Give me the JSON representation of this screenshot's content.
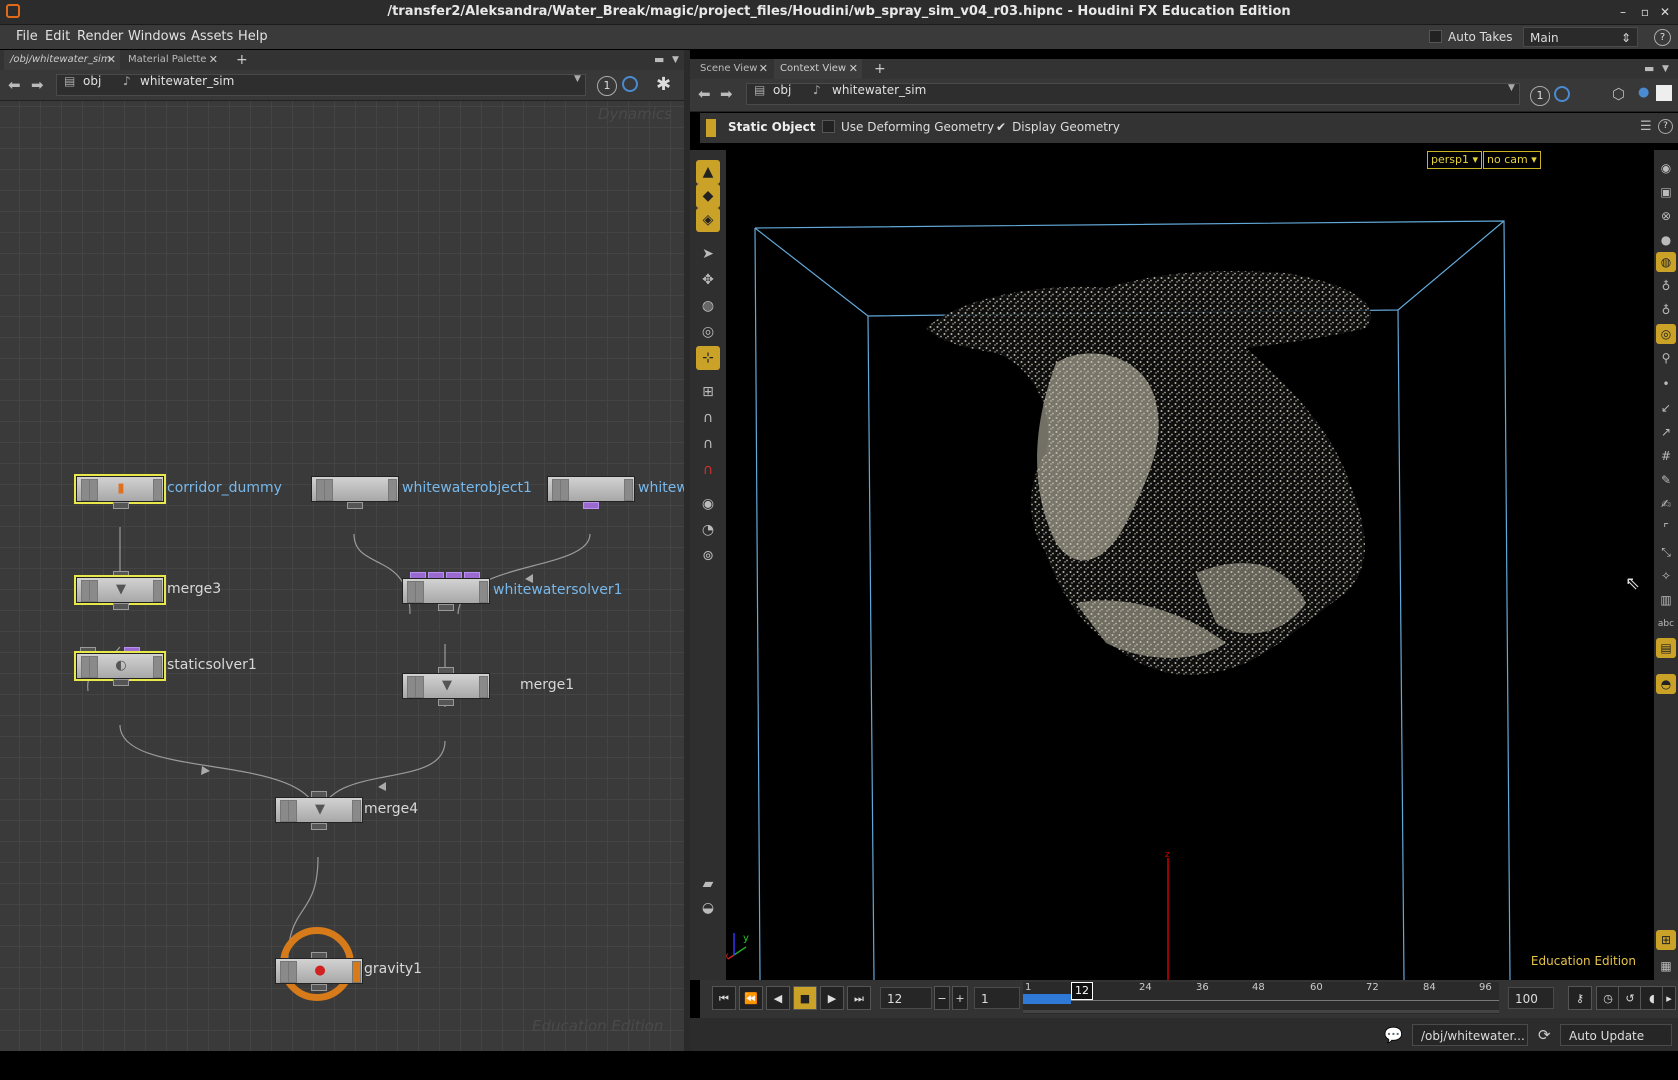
{
  "window": {
    "title": "/transfer2/Aleksandra/Water_Break/magic/project_files/Houdini/wb_spray_sim_v04_r03.hipnc - Houdini FX Education Edition",
    "logo_icon": "houdini-logo-icon"
  },
  "menu": {
    "items": [
      "File",
      "Edit",
      "Render",
      "Windows",
      "Assets",
      "Help"
    ],
    "auto_takes_label": "Auto Takes",
    "desktop_dropdown": "Main",
    "help_label": "?"
  },
  "left_pane": {
    "tabs": [
      "/obj/whitewater_sim",
      "Material Palette"
    ],
    "path": {
      "root": "obj",
      "node": "whitewater_sim"
    },
    "counter": "1",
    "network_watermark_top": "Dynamics",
    "network_watermark_bottom": "Education Edition",
    "nodes": {
      "corridor_dummy": "corridor_dummy",
      "whitewaterobject1": "whitewaterobject1",
      "whitew": "whitew",
      "merge3": "merge3",
      "whitewatersolver1": "whitewatersolver1",
      "staticsolver1": "staticsolver1",
      "merge1": "merge1",
      "merge4": "merge4",
      "gravity1": "gravity1"
    }
  },
  "right_pane": {
    "tabs": [
      "Scene View",
      "Context View"
    ],
    "path": {
      "root": "obj",
      "node": "whitewater_sim"
    },
    "counter": "1",
    "viewer_bar": {
      "static_object": "Static Object",
      "use_deforming_geometry": "Use Deforming Geometry",
      "display_geometry": "Display Geometry"
    },
    "camera": {
      "view": "persp1",
      "cam": "no cam"
    },
    "education_label": "Education Edition",
    "axis_labels": {
      "y": "y",
      "x": "x",
      "z": "z"
    },
    "colors": {
      "bbox": "#62a8d8",
      "particles": "#d8d4c0",
      "accent": "#c9a227"
    }
  },
  "playbar": {
    "current_frame": "12",
    "step": "1",
    "end_frame": "100",
    "timeline_start": "1",
    "timeline_current": "12",
    "ticks": [
      "24",
      "36",
      "48",
      "60",
      "72",
      "84",
      "96"
    ]
  },
  "statusbar": {
    "path": "/obj/whitewater...",
    "update_mode": "Auto Update"
  }
}
